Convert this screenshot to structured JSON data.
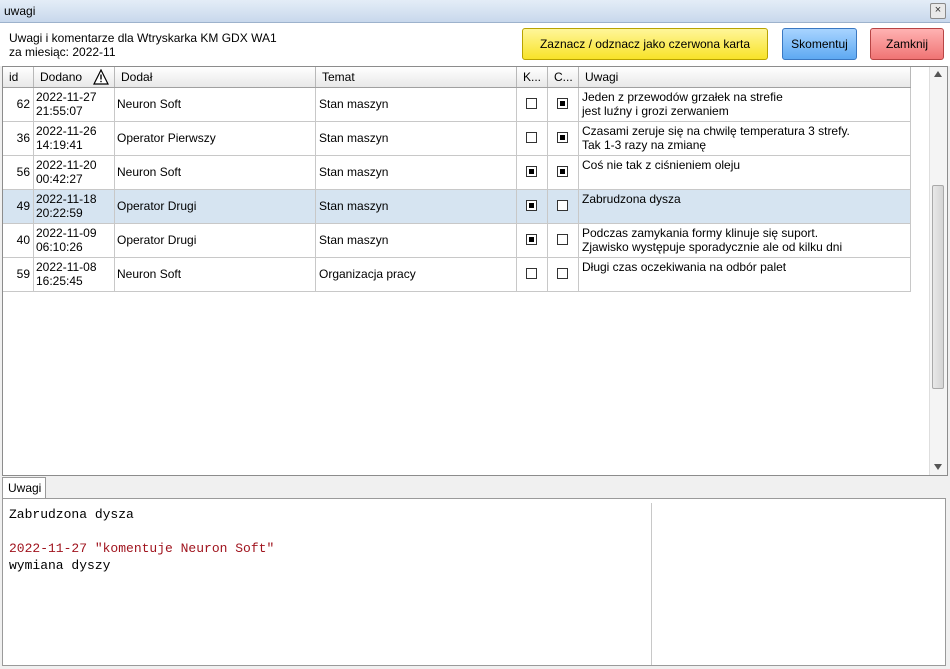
{
  "window": {
    "title": "uwagi",
    "close_glyph": "×"
  },
  "header": {
    "line1": "Uwagi i komentarze dla Wtryskarka KM GDX WA1",
    "line2": "za miesiąc: 2022-11"
  },
  "buttons": {
    "red_card": "Zaznacz / odznacz jako czerwona karta",
    "comment": "Skomentuj",
    "close": "Zamknij"
  },
  "colors": {
    "selected_row": "#d6e4f1",
    "comment_header_red": "#a0141e",
    "btn_yellow": "#f8e328",
    "btn_blue": "#5ea9f2",
    "btn_red": "#f07474"
  },
  "table": {
    "columns": [
      "id",
      "Dodano",
      "Dodał",
      "Temat",
      "K...",
      "C...",
      "Uwagi"
    ],
    "rows": [
      {
        "id": "62",
        "date": "2022-11-27",
        "time": "21:55:07",
        "added_by": "Neuron Soft",
        "topic": "Stan maszyn",
        "k": false,
        "c": true,
        "note1": "Jeden z przewodów grzałek na strefie",
        "note2": "jest luźny i grozi zerwaniem"
      },
      {
        "id": "36",
        "date": "2022-11-26",
        "time": "14:19:41",
        "added_by": "Operator Pierwszy",
        "topic": "Stan maszyn",
        "k": false,
        "c": true,
        "note1": "Czasami zeruje się na chwilę temperatura 3 strefy.",
        "note2": "Tak 1-3 razy na zmianę"
      },
      {
        "id": "56",
        "date": "2022-11-20",
        "time": "00:42:27",
        "added_by": "Neuron Soft",
        "topic": "Stan maszyn",
        "k": true,
        "c": true,
        "note1": "Coś nie tak z ciśnieniem oleju",
        "note2": ""
      },
      {
        "id": "49",
        "date": "2022-11-18",
        "time": "20:22:59",
        "added_by": "Operator Drugi",
        "topic": "Stan maszyn",
        "k": true,
        "c": false,
        "note1": "Zabrudzona dysza",
        "note2": "",
        "selected": true
      },
      {
        "id": "40",
        "date": "2022-11-09",
        "time": "06:10:26",
        "added_by": "Operator Drugi",
        "topic": "Stan maszyn",
        "k": true,
        "c": false,
        "note1": "Podczas zamykania formy klinuje się suport.",
        "note2": "Zjawisko występuje sporadycznie ale od kilku dni"
      },
      {
        "id": "59",
        "date": "2022-11-08",
        "time": "16:25:45",
        "added_by": "Neuron Soft",
        "topic": "Organizacja pracy",
        "k": false,
        "c": false,
        "note1": "Długi czas oczekiwania na odbór palet",
        "note2": ""
      }
    ]
  },
  "tabs": {
    "notes": "Uwagi"
  },
  "details": {
    "note": "Zabrudzona dysza",
    "comment_header": "2022-11-27 \"komentuje  Neuron Soft\"",
    "comment_body": "wymiana dyszy"
  },
  "icons": {
    "warning": "warning-triangle-icon",
    "scroll_up": "chevron-up-icon",
    "scroll_down": "chevron-down-icon"
  }
}
